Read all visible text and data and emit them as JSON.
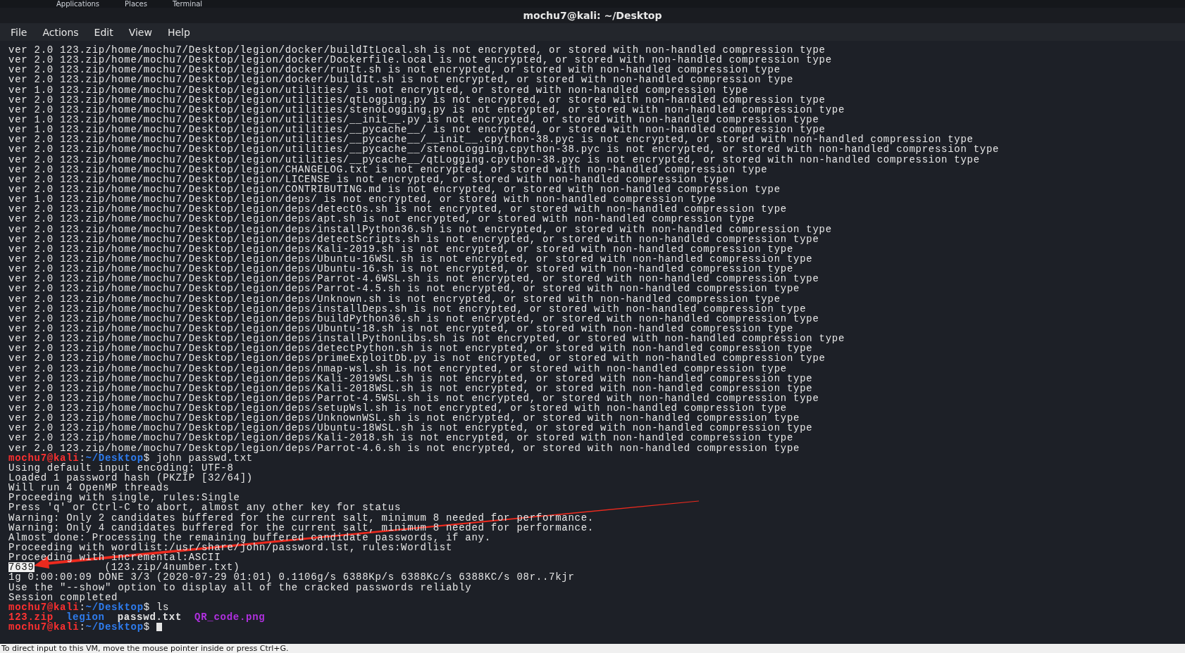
{
  "top_panel": {
    "items": [
      "Applications",
      "Places",
      "Terminal"
    ]
  },
  "window": {
    "title": "mochu7@kali: ~/Desktop"
  },
  "menu": [
    "File",
    "Actions",
    "Edit",
    "View",
    "Help"
  ],
  "terminal": {
    "lines": [
      {
        "kind": "output",
        "text": "ver 2.0 123.zip/home/mochu7/Desktop/legion/docker/buildItLocal.sh is not encrypted, or stored with non-handled compression type"
      },
      {
        "kind": "output",
        "text": "ver 2.0 123.zip/home/mochu7/Desktop/legion/docker/Dockerfile.local is not encrypted, or stored with non-handled compression type"
      },
      {
        "kind": "output",
        "text": "ver 2.0 123.zip/home/mochu7/Desktop/legion/docker/runIt.sh is not encrypted, or stored with non-handled compression type"
      },
      {
        "kind": "output",
        "text": "ver 2.0 123.zip/home/mochu7/Desktop/legion/docker/buildIt.sh is not encrypted, or stored with non-handled compression type"
      },
      {
        "kind": "output",
        "text": "ver 1.0 123.zip/home/mochu7/Desktop/legion/utilities/ is not encrypted, or stored with non-handled compression type"
      },
      {
        "kind": "output",
        "text": "ver 2.0 123.zip/home/mochu7/Desktop/legion/utilities/qtLogging.py is not encrypted, or stored with non-handled compression type"
      },
      {
        "kind": "output",
        "text": "ver 2.0 123.zip/home/mochu7/Desktop/legion/utilities/stenoLogging.py is not encrypted, or stored with non-handled compression type"
      },
      {
        "kind": "output",
        "text": "ver 1.0 123.zip/home/mochu7/Desktop/legion/utilities/__init__.py is not encrypted, or stored with non-handled compression type"
      },
      {
        "kind": "output",
        "text": "ver 1.0 123.zip/home/mochu7/Desktop/legion/utilities/__pycache__/ is not encrypted, or stored with non-handled compression type"
      },
      {
        "kind": "output",
        "text": "ver 2.0 123.zip/home/mochu7/Desktop/legion/utilities/__pycache__/__init__.cpython-38.pyc is not encrypted, or stored with non-handled compression type"
      },
      {
        "kind": "output",
        "text": "ver 2.0 123.zip/home/mochu7/Desktop/legion/utilities/__pycache__/stenoLogging.cpython-38.pyc is not encrypted, or stored with non-handled compression type"
      },
      {
        "kind": "output",
        "text": "ver 2.0 123.zip/home/mochu7/Desktop/legion/utilities/__pycache__/qtLogging.cpython-38.pyc is not encrypted, or stored with non-handled compression type"
      },
      {
        "kind": "output",
        "text": "ver 2.0 123.zip/home/mochu7/Desktop/legion/CHANGELOG.txt is not encrypted, or stored with non-handled compression type"
      },
      {
        "kind": "output",
        "text": "ver 2.0 123.zip/home/mochu7/Desktop/legion/LICENSE is not encrypted, or stored with non-handled compression type"
      },
      {
        "kind": "output",
        "text": "ver 2.0 123.zip/home/mochu7/Desktop/legion/CONTRIBUTING.md is not encrypted, or stored with non-handled compression type"
      },
      {
        "kind": "output",
        "text": "ver 1.0 123.zip/home/mochu7/Desktop/legion/deps/ is not encrypted, or stored with non-handled compression type"
      },
      {
        "kind": "output",
        "text": "ver 2.0 123.zip/home/mochu7/Desktop/legion/deps/detectOs.sh is not encrypted, or stored with non-handled compression type"
      },
      {
        "kind": "output",
        "text": "ver 2.0 123.zip/home/mochu7/Desktop/legion/deps/apt.sh is not encrypted, or stored with non-handled compression type"
      },
      {
        "kind": "output",
        "text": "ver 2.0 123.zip/home/mochu7/Desktop/legion/deps/installPython36.sh is not encrypted, or stored with non-handled compression type"
      },
      {
        "kind": "output",
        "text": "ver 2.0 123.zip/home/mochu7/Desktop/legion/deps/detectScripts.sh is not encrypted, or stored with non-handled compression type"
      },
      {
        "kind": "output",
        "text": "ver 2.0 123.zip/home/mochu7/Desktop/legion/deps/Kali-2019.sh is not encrypted, or stored with non-handled compression type"
      },
      {
        "kind": "output",
        "text": "ver 2.0 123.zip/home/mochu7/Desktop/legion/deps/Ubuntu-16WSL.sh is not encrypted, or stored with non-handled compression type"
      },
      {
        "kind": "output",
        "text": "ver 2.0 123.zip/home/mochu7/Desktop/legion/deps/Ubuntu-16.sh is not encrypted, or stored with non-handled compression type"
      },
      {
        "kind": "output",
        "text": "ver 2.0 123.zip/home/mochu7/Desktop/legion/deps/Parrot-4.6WSL.sh is not encrypted, or stored with non-handled compression type"
      },
      {
        "kind": "output",
        "text": "ver 2.0 123.zip/home/mochu7/Desktop/legion/deps/Parrot-4.5.sh is not encrypted, or stored with non-handled compression type"
      },
      {
        "kind": "output",
        "text": "ver 2.0 123.zip/home/mochu7/Desktop/legion/deps/Unknown.sh is not encrypted, or stored with non-handled compression type"
      },
      {
        "kind": "output",
        "text": "ver 2.0 123.zip/home/mochu7/Desktop/legion/deps/installDeps.sh is not encrypted, or stored with non-handled compression type"
      },
      {
        "kind": "output",
        "text": "ver 2.0 123.zip/home/mochu7/Desktop/legion/deps/buildPython36.sh is not encrypted, or stored with non-handled compression type"
      },
      {
        "kind": "output",
        "text": "ver 2.0 123.zip/home/mochu7/Desktop/legion/deps/Ubuntu-18.sh is not encrypted, or stored with non-handled compression type"
      },
      {
        "kind": "output",
        "text": "ver 2.0 123.zip/home/mochu7/Desktop/legion/deps/installPythonLibs.sh is not encrypted, or stored with non-handled compression type"
      },
      {
        "kind": "output",
        "text": "ver 2.0 123.zip/home/mochu7/Desktop/legion/deps/detectPython.sh is not encrypted, or stored with non-handled compression type"
      },
      {
        "kind": "output",
        "text": "ver 2.0 123.zip/home/mochu7/Desktop/legion/deps/primeExploitDb.py is not encrypted, or stored with non-handled compression type"
      },
      {
        "kind": "output",
        "text": "ver 2.0 123.zip/home/mochu7/Desktop/legion/deps/nmap-wsl.sh is not encrypted, or stored with non-handled compression type"
      },
      {
        "kind": "output",
        "text": "ver 2.0 123.zip/home/mochu7/Desktop/legion/deps/Kali-2019WSL.sh is not encrypted, or stored with non-handled compression type"
      },
      {
        "kind": "output",
        "text": "ver 2.0 123.zip/home/mochu7/Desktop/legion/deps/Kali-2018WSL.sh is not encrypted, or stored with non-handled compression type"
      },
      {
        "kind": "output",
        "text": "ver 2.0 123.zip/home/mochu7/Desktop/legion/deps/Parrot-4.5WSL.sh is not encrypted, or stored with non-handled compression type"
      },
      {
        "kind": "output",
        "text": "ver 2.0 123.zip/home/mochu7/Desktop/legion/deps/setupWsl.sh is not encrypted, or stored with non-handled compression type"
      },
      {
        "kind": "output",
        "text": "ver 2.0 123.zip/home/mochu7/Desktop/legion/deps/UnknownWSL.sh is not encrypted, or stored with non-handled compression type"
      },
      {
        "kind": "output",
        "text": "ver 2.0 123.zip/home/mochu7/Desktop/legion/deps/Ubuntu-18WSL.sh is not encrypted, or stored with non-handled compression type"
      },
      {
        "kind": "output",
        "text": "ver 2.0 123.zip/home/mochu7/Desktop/legion/deps/Kali-2018.sh is not encrypted, or stored with non-handled compression type"
      },
      {
        "kind": "output",
        "text": "ver 2.0 123.zip/home/mochu7/Desktop/legion/deps/Parrot-4.6.sh is not encrypted, or stored with non-handled compression type"
      },
      {
        "kind": "prompt",
        "user": "mochu7@kali",
        "sep": ":",
        "path": "~/Desktop",
        "symbol": "$",
        "command": "john passwd.txt",
        "cursor": false
      },
      {
        "kind": "output",
        "text": "Using default input encoding: UTF-8"
      },
      {
        "kind": "output",
        "text": "Loaded 1 password hash (PKZIP [32/64])"
      },
      {
        "kind": "output",
        "text": "Will run 4 OpenMP threads"
      },
      {
        "kind": "output",
        "text": "Proceeding with single, rules:Single"
      },
      {
        "kind": "output",
        "text": "Press 'q' or Ctrl-C to abort, almost any other key for status"
      },
      {
        "kind": "output",
        "text": "Warning: Only 2 candidates buffered for the current salt, minimum 8 needed for performance."
      },
      {
        "kind": "output",
        "text": "Warning: Only 4 candidates buffered for the current salt, minimum 8 needed for performance."
      },
      {
        "kind": "output",
        "text": "Almost done: Processing the remaining buffered candidate passwords, if any."
      },
      {
        "kind": "output",
        "text": "Proceeding with wordlist:/usr/share/john/password.lst, rules:Wordlist"
      },
      {
        "kind": "output",
        "text": "Proceeding with incremental:ASCII"
      },
      {
        "kind": "found",
        "password": "7639",
        "detail": "(123.zip/4number.txt)"
      },
      {
        "kind": "output",
        "text": "1g 0:00:00:09 DONE 3/3 (2020-07-29 01:01) 0.1106g/s 6388Kp/s 6388Kc/s 6388KC/s 08r..7kjr"
      },
      {
        "kind": "output",
        "text": "Use the \"--show\" option to display all of the cracked passwords reliably"
      },
      {
        "kind": "output",
        "text": "Session completed"
      },
      {
        "kind": "prompt",
        "user": "mochu7@kali",
        "sep": ":",
        "path": "~/Desktop",
        "symbol": "$",
        "command": "ls",
        "cursor": false
      },
      {
        "kind": "files",
        "files": [
          {
            "name": "123.zip",
            "color": "#ff3333"
          },
          {
            "name": "legion",
            "color": "#2f7df0"
          },
          {
            "name": "passwd.txt",
            "color": "#e6e6e6"
          },
          {
            "name": "QR_code.png",
            "color": "#b030e0"
          }
        ]
      },
      {
        "kind": "prompt",
        "user": "mochu7@kali",
        "sep": ":",
        "path": "~/Desktop",
        "symbol": "$",
        "cursor": true
      }
    ]
  },
  "status_bar": "To direct input to this VM, move the mouse pointer inside or press Ctrl+G."
}
